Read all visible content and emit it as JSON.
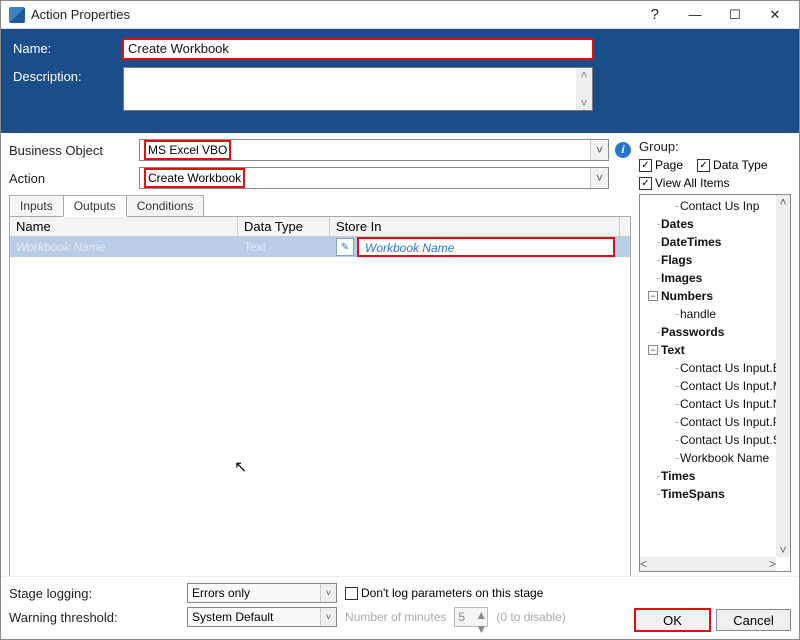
{
  "window": {
    "title": "Action Properties"
  },
  "header": {
    "name_label": "Name:",
    "name_value": "Create Workbook",
    "description_label": "Description:",
    "description_value": ""
  },
  "controls": {
    "business_object_label": "Business Object",
    "business_object_value": "MS Excel VBO",
    "action_label": "Action",
    "action_value": "Create Workbook"
  },
  "tabs": {
    "inputs": "Inputs",
    "outputs": "Outputs",
    "conditions": "Conditions"
  },
  "grid": {
    "col_name": "Name",
    "col_data_type": "Data Type",
    "col_store_in": "Store In",
    "rows": [
      {
        "name": "Workbook Name",
        "data_type": "Text",
        "store_in": "Workbook Name"
      }
    ]
  },
  "group": {
    "label": "Group:",
    "page": "Page",
    "data_type": "Data Type",
    "view_all": "View All Items"
  },
  "tree": {
    "root": "Contact Us Inp",
    "items": {
      "dates": "Dates",
      "datetimes": "DateTimes",
      "flags": "Flags",
      "images": "Images",
      "numbers": "Numbers",
      "handle": "handle",
      "passwords": "Passwords",
      "text": "Text",
      "text_children": {
        "e": "Contact Us Input.E",
        "m": "Contact Us Input.M",
        "n": "Contact Us Input.N",
        "p": "Contact Us Input.P",
        "s": "Contact Us Input.S",
        "wb": "Workbook Name"
      },
      "times": "Times",
      "timespans": "TimeSpans"
    }
  },
  "footer": {
    "stage_logging_label": "Stage logging:",
    "stage_logging_value": "Errors only",
    "dont_log": "Don't log parameters on this stage",
    "warning_threshold_label": "Warning threshold:",
    "warning_threshold_value": "System Default",
    "num_minutes_label": "Number of minutes",
    "num_minutes_value": "5",
    "to_disable": "(0 to disable)",
    "ok": "OK",
    "cancel": "Cancel"
  }
}
